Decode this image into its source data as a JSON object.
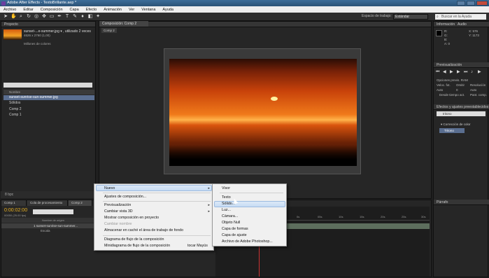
{
  "window": {
    "title": "Adobe After Effects - TextoBrillante.aep *"
  },
  "menubar": [
    "Archivo",
    "Editar",
    "Composición",
    "Capa",
    "Efecto",
    "Animación",
    "Ver",
    "Ventana",
    "Ayuda"
  ],
  "toolbar": {
    "workspace_label": "Espacio de trabajo:",
    "workspace_value": "Estándar",
    "help_search_placeholder": "Buscar en la Ayuda"
  },
  "project": {
    "tab": "Proyecto",
    "asset_name": "sunset-...e-summer.jpg ▾ , utilizado 2 veces",
    "asset_dims": "4626 x 2760 (1,00)",
    "asset_colors": "Millones de colores",
    "column_header": "Nombre",
    "items": [
      "sunset-sunrise-sun-summer.jpg",
      "Sólidos",
      "Comp 2",
      "Comp 1"
    ],
    "bottom": "8 bpc"
  },
  "composition": {
    "tab": "Composición: Comp 2",
    "subtab": "Comp 2"
  },
  "info": {
    "tab": "Información",
    "audio_tab": "Audio",
    "r": "R:",
    "g": "G:",
    "b": "B:",
    "a": "A: 0",
    "x": "X: 576",
    "y": "Y: 1173"
  },
  "preview": {
    "tab": "Previsualización",
    "options": "Opciones previs. RAM",
    "rate_label": "Veloc. fot.",
    "skip_label": "Omitir",
    "res_label": "Resolución",
    "auto": "Auto",
    "auto2": "Auto",
    "skip_value": "0",
    "from_current": "Desde tiempo act.",
    "full_screen": "Pant. comp."
  },
  "effects": {
    "tab": "Efectos y ajustes preestablecidos",
    "search": "tritono",
    "category": "▾ Corrección de color",
    "item": "Tritono"
  },
  "paragraph": {
    "tab": "Párrafo"
  },
  "timeline": {
    "tabs": [
      "Comp 1",
      "Cola de procesamiento",
      "Comp 2"
    ],
    "timecode": "0:00:02:00",
    "frames": "00050 (25.00 fps)",
    "col_header": "Nombre de origen",
    "layer_num": "1",
    "layer_name": "sunset-sunrise-sun-summer...",
    "layer_prop": "Escala",
    "ruler": [
      "0s",
      "05s",
      "10s",
      "15s",
      "20s",
      "25s",
      "30s"
    ]
  },
  "context_menu": {
    "items": [
      "Nuevo",
      "Ajustes de composición...",
      "Previsualización",
      "Cambiar vista 3D",
      "Mostrar composición en proyecto",
      "Cambiar nombre",
      "Almacenar en caché el área de trabajo de fondo",
      "Diagrama de flujo de la composición",
      "Minidiagrama de flujo de la composición"
    ],
    "shortcut": "tocar Mayús"
  },
  "submenu": {
    "items": [
      "Visor",
      "Texto",
      "Sólido...",
      "Luz...",
      "Cámara...",
      "Objeto Null",
      "Capa de formas",
      "Capa de ajuste",
      "Archivo de Adobe Photoshop..."
    ]
  }
}
